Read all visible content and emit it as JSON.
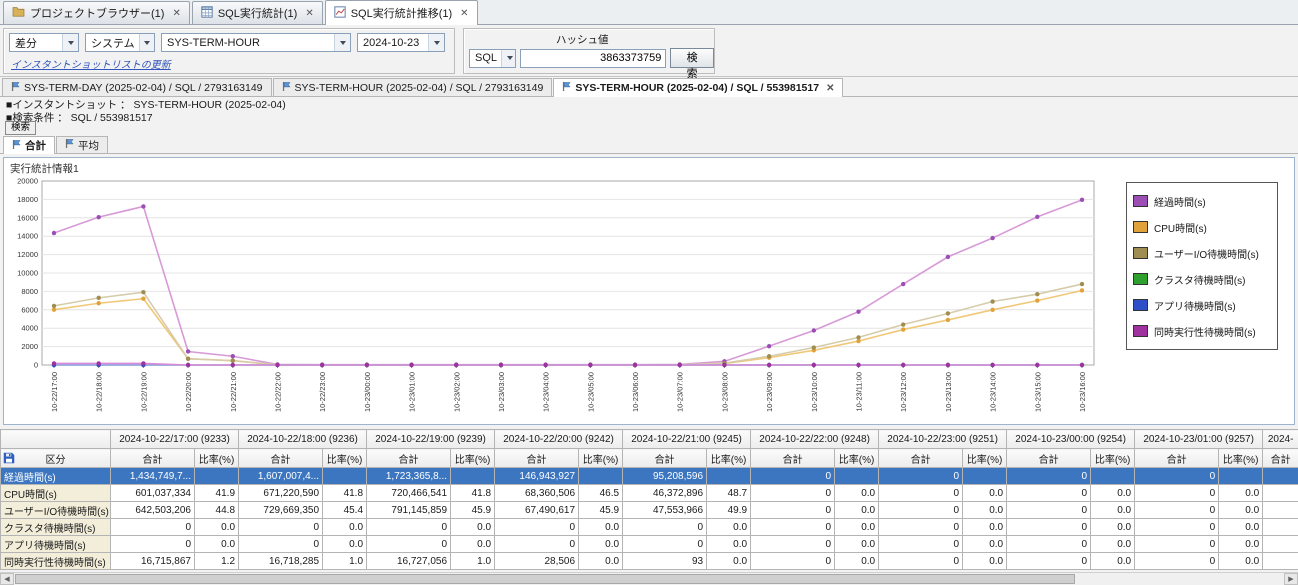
{
  "main_tabs": [
    {
      "label": "プロジェクトブラウザー(1)"
    },
    {
      "label": "SQL実行統計(1)"
    },
    {
      "label": "SQL実行統計推移(1)"
    }
  ],
  "toolbar": {
    "diff_select": "差分",
    "system_select": "システム",
    "snapshot_select": "SYS-TERM-HOUR",
    "date_select": "2024-10-23",
    "update_link": "インスタントショットリストの更新",
    "hash_group": {
      "label": "ハッシュ値",
      "type_select": "SQL",
      "hash_value": "3863373759",
      "search_button": "検索"
    }
  },
  "doc_tabs": [
    {
      "label": "SYS-TERM-DAY (2025-02-04) / SQL / 2793163149"
    },
    {
      "label": "SYS-TERM-HOUR (2025-02-04) / SQL / 2793163149"
    },
    {
      "label": "SYS-TERM-HOUR (2025-02-04) / SQL / 553981517"
    }
  ],
  "info": {
    "snapshot_line": "■インスタントショット ： SYS-TERM-HOUR (2025-02-04)",
    "condition_line": "■検索条件 ： SQL / 553981517",
    "search_button": "検索"
  },
  "view_tabs": [
    {
      "label": "合計"
    },
    {
      "label": "平均"
    }
  ],
  "chart_title": "実行統計情報1",
  "chart_data": {
    "type": "line",
    "title": "実行統計情報1",
    "ylim": [
      0,
      20000
    ],
    "ytick_step": 2000,
    "grid": true,
    "legend_position": "right",
    "x": [
      "10-22/17:00",
      "10-22/18:00",
      "10-22/19:00",
      "10-22/20:00",
      "10-22/21:00",
      "10-22/22:00",
      "10-22/23:00",
      "10-23/00:00",
      "10-23/01:00",
      "10-23/02:00",
      "10-23/03:00",
      "10-23/04:00",
      "10-23/05:00",
      "10-23/06:00",
      "10-23/07:00",
      "10-23/08:00",
      "10-23/09:00",
      "10-23/10:00",
      "10-23/11:00",
      "10-23/12:00",
      "10-23/13:00",
      "10-23/14:00",
      "10-23/15:00",
      "10-23/16:00"
    ],
    "series": [
      {
        "name": "経過時間(s)",
        "color": "#9b4fb5",
        "line_color": "#d79ad7",
        "values": [
          14347,
          16070,
          17234,
          1469,
          952,
          60,
          40,
          40,
          40,
          40,
          40,
          40,
          40,
          40,
          60,
          400,
          2050,
          3750,
          5800,
          8800,
          11750,
          13800,
          16100,
          17950
        ]
      },
      {
        "name": "CPU時間(s)",
        "color": "#e0a23a",
        "line_color": "#f0c878",
        "values": [
          6010,
          6712,
          7205,
          684,
          464,
          20,
          10,
          10,
          10,
          10,
          10,
          10,
          10,
          10,
          20,
          150,
          800,
          1600,
          2600,
          3850,
          4900,
          6000,
          7000,
          8100
        ]
      },
      {
        "name": "ユーザーI/O待機時間(s)",
        "color": "#a08d52",
        "line_color": "#d6ccaa",
        "values": [
          6425,
          7297,
          7911,
          675,
          476,
          20,
          10,
          10,
          10,
          10,
          10,
          10,
          10,
          10,
          20,
          200,
          950,
          1900,
          3000,
          4400,
          5600,
          6900,
          7700,
          8800
        ]
      },
      {
        "name": "クラスタ待機時間(s)",
        "color": "#2ea02e",
        "line_color": "#8fd08f",
        "values": [
          0,
          0,
          0,
          0,
          0,
          0,
          0,
          0,
          0,
          0,
          0,
          0,
          0,
          0,
          0,
          0,
          0,
          0,
          0,
          0,
          0,
          0,
          0,
          0
        ]
      },
      {
        "name": "アプリ待機時間(s)",
        "color": "#2f4fc9",
        "line_color": "#8fa0e8",
        "values": [
          0,
          0,
          0,
          0,
          0,
          0,
          0,
          0,
          0,
          0,
          0,
          0,
          0,
          0,
          0,
          0,
          0,
          0,
          0,
          0,
          0,
          0,
          0,
          0
        ]
      },
      {
        "name": "同時実行性待機時間(s)",
        "color": "#a032a0",
        "line_color": "#d88ad8",
        "values": [
          167,
          167,
          167,
          0,
          0,
          0,
          0,
          0,
          0,
          0,
          0,
          0,
          0,
          0,
          0,
          0,
          0,
          0,
          0,
          0,
          0,
          0,
          0,
          0
        ]
      }
    ]
  },
  "table": {
    "corner_label": "区分",
    "sub_total": "合計",
    "sub_ratio": "比率(%)",
    "columns": [
      "2024-10-22/17:00 (9233)",
      "2024-10-22/18:00 (9236)",
      "2024-10-22/19:00 (9239)",
      "2024-10-22/20:00 (9242)",
      "2024-10-22/21:00 (9245)",
      "2024-10-22/22:00 (9248)",
      "2024-10-22/23:00 (9251)",
      "2024-10-23/00:00 (9254)",
      "2024-10-23/01:00 (9257)",
      "2024-"
    ],
    "rows": [
      {
        "label": "経過時間(s)",
        "selected": true,
        "cells": [
          [
            "1,434,749,7...",
            ""
          ],
          [
            "1,607,007,4...",
            ""
          ],
          [
            "1,723,365,8...",
            ""
          ],
          [
            "146,943,927",
            ""
          ],
          [
            "95,208,596",
            ""
          ],
          [
            "0",
            ""
          ],
          [
            "0",
            ""
          ],
          [
            "0",
            ""
          ],
          [
            "0",
            ""
          ],
          [
            "",
            ""
          ]
        ]
      },
      {
        "label": "CPU時間(s)",
        "cells": [
          [
            "601,037,334",
            "41.9"
          ],
          [
            "671,220,590",
            "41.8"
          ],
          [
            "720,466,541",
            "41.8"
          ],
          [
            "68,360,506",
            "46.5"
          ],
          [
            "46,372,896",
            "48.7"
          ],
          [
            "0",
            "0.0"
          ],
          [
            "0",
            "0.0"
          ],
          [
            "0",
            "0.0"
          ],
          [
            "0",
            "0.0"
          ],
          [
            "",
            ""
          ]
        ]
      },
      {
        "label": "ユーザーI/O待機時間(s)",
        "cells": [
          [
            "642,503,206",
            "44.8"
          ],
          [
            "729,669,350",
            "45.4"
          ],
          [
            "791,145,859",
            "45.9"
          ],
          [
            "67,490,617",
            "45.9"
          ],
          [
            "47,553,966",
            "49.9"
          ],
          [
            "0",
            "0.0"
          ],
          [
            "0",
            "0.0"
          ],
          [
            "0",
            "0.0"
          ],
          [
            "0",
            "0.0"
          ],
          [
            "",
            ""
          ]
        ]
      },
      {
        "label": "クラスタ待機時間(s)",
        "cells": [
          [
            "0",
            "0.0"
          ],
          [
            "0",
            "0.0"
          ],
          [
            "0",
            "0.0"
          ],
          [
            "0",
            "0.0"
          ],
          [
            "0",
            "0.0"
          ],
          [
            "0",
            "0.0"
          ],
          [
            "0",
            "0.0"
          ],
          [
            "0",
            "0.0"
          ],
          [
            "0",
            "0.0"
          ],
          [
            "",
            ""
          ]
        ]
      },
      {
        "label": "アプリ待機時間(s)",
        "cells": [
          [
            "0",
            "0.0"
          ],
          [
            "0",
            "0.0"
          ],
          [
            "0",
            "0.0"
          ],
          [
            "0",
            "0.0"
          ],
          [
            "0",
            "0.0"
          ],
          [
            "0",
            "0.0"
          ],
          [
            "0",
            "0.0"
          ],
          [
            "0",
            "0.0"
          ],
          [
            "0",
            "0.0"
          ],
          [
            "",
            ""
          ]
        ]
      },
      {
        "label": "同時実行性待機時間(s)",
        "cells": [
          [
            "16,715,867",
            "1.2"
          ],
          [
            "16,718,285",
            "1.0"
          ],
          [
            "16,727,056",
            "1.0"
          ],
          [
            "28,506",
            "0.0"
          ],
          [
            "93",
            "0.0"
          ],
          [
            "0",
            "0.0"
          ],
          [
            "0",
            "0.0"
          ],
          [
            "0",
            "0.0"
          ],
          [
            "0",
            "0.0"
          ],
          [
            "",
            ""
          ]
        ]
      }
    ]
  }
}
